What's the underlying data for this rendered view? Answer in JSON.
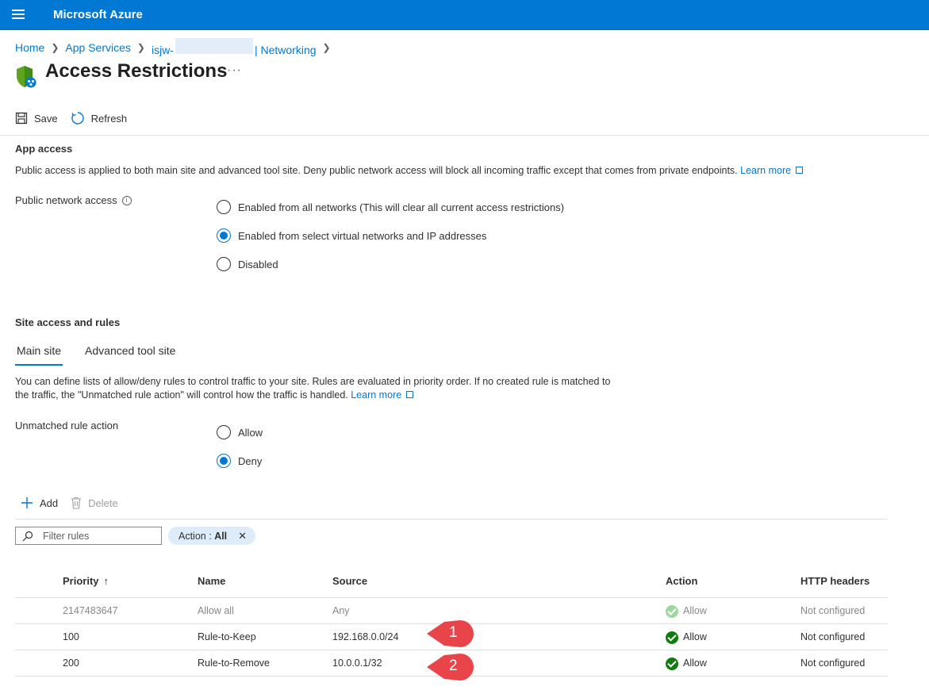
{
  "app": {
    "brand": "Microsoft Azure"
  },
  "breadcrumb": {
    "home": "Home",
    "app_services": "App Services",
    "resource_prefix": "isjw-",
    "resource_suffix": "| Networking"
  },
  "page": {
    "title": "Access Restrictions",
    "more": "···"
  },
  "toolbar": {
    "save_label": "Save",
    "refresh_label": "Refresh"
  },
  "app_access": {
    "heading": "App access",
    "description": "Public access is applied to both main site and advanced tool site. Deny public network access will block all incoming traffic except that comes from private endpoints.",
    "learn_more": "Learn more",
    "public_network_label": "Public network access",
    "options": [
      {
        "label": "Enabled from all networks (This will clear all current access restrictions)",
        "checked": false
      },
      {
        "label": "Enabled from select virtual networks and IP addresses",
        "checked": true
      },
      {
        "label": "Disabled",
        "checked": false
      }
    ]
  },
  "site_access": {
    "heading": "Site access and rules",
    "tabs": [
      {
        "label": "Main site",
        "active": true
      },
      {
        "label": "Advanced tool site",
        "active": false
      }
    ],
    "description_line1": "You can define lists of allow/deny rules to control traffic to your site. Rules are evaluated in priority order. If no created rule is matched to",
    "description_line2": "the traffic, the \"Unmatched rule action\" will control how the traffic is handled.",
    "learn_more": "Learn more",
    "unmatched_label": "Unmatched rule action",
    "unmatched_options": [
      {
        "label": "Allow",
        "checked": false
      },
      {
        "label": "Deny",
        "checked": true
      }
    ]
  },
  "rule_actions": {
    "add_label": "Add",
    "delete_label": "Delete"
  },
  "filter": {
    "placeholder": "Filter rules",
    "pill_label": "Action : ",
    "pill_value": "All"
  },
  "table": {
    "columns": [
      "Priority",
      "Name",
      "Source",
      "Action",
      "HTTP headers"
    ],
    "sort_indicator": "↑",
    "rows": [
      {
        "priority": "2147483647",
        "name": "Allow all",
        "source": "Any",
        "action": "Allow",
        "headers": "Not configured",
        "muted": true
      },
      {
        "priority": "100",
        "name": "Rule-to-Keep",
        "source": "192.168.0.0/24",
        "action": "Allow",
        "headers": "Not configured",
        "muted": false
      },
      {
        "priority": "200",
        "name": "Rule-to-Remove",
        "source": "10.0.0.1/32",
        "action": "Allow",
        "headers": "Not configured",
        "muted": false
      }
    ]
  },
  "callouts": [
    "1",
    "2"
  ],
  "colors": {
    "accent": "#0078d4",
    "callout": "#e8444a",
    "success": "#107c10"
  },
  "icons": [
    "menu-icon",
    "shield-icon",
    "save-icon",
    "refresh-icon",
    "info-icon",
    "external-link-icon",
    "add-icon",
    "delete-icon",
    "search-icon",
    "close-icon",
    "check-circle-icon"
  ]
}
